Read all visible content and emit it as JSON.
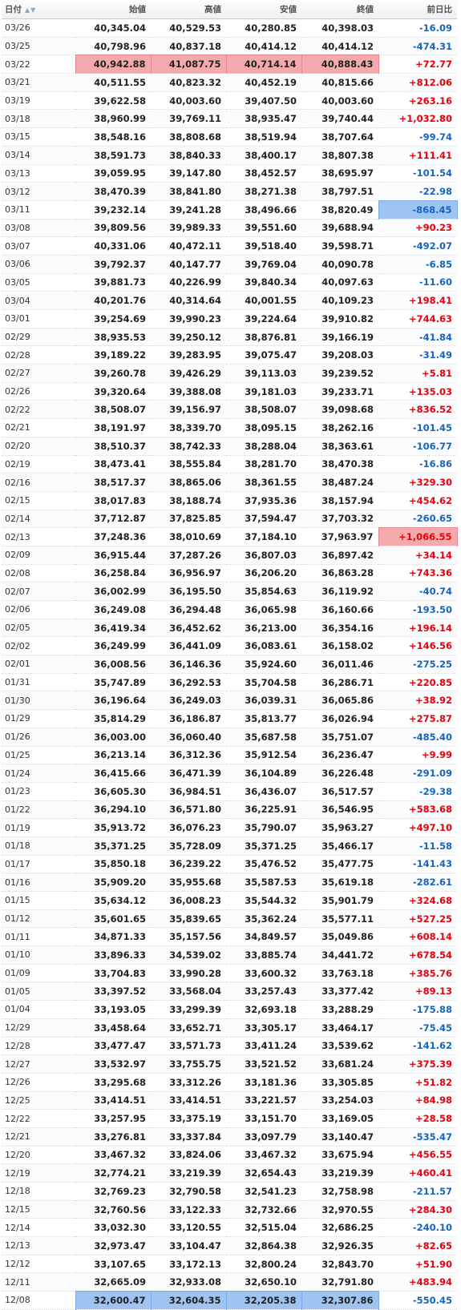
{
  "headers": {
    "date": "日付",
    "open": "始値",
    "high": "高値",
    "low": "安値",
    "close": "終値",
    "change": "前日比"
  },
  "colors": {
    "up": "#e8000d",
    "down": "#1565c0",
    "highlight_red": "#f4a9ad",
    "highlight_blue": "#9fc4f2"
  },
  "rows": [
    {
      "date": "03/26",
      "open": "40,345.04",
      "high": "40,529.53",
      "low": "40,280.85",
      "close": "40,398.03",
      "change": "-16.09"
    },
    {
      "date": "03/25",
      "open": "40,798.96",
      "high": "40,837.18",
      "low": "40,414.12",
      "close": "40,414.12",
      "change": "-474.31"
    },
    {
      "date": "03/22",
      "open": "40,942.88",
      "high": "41,087.75",
      "low": "40,714.14",
      "close": "40,888.43",
      "change": "+72.77",
      "hl": [
        "open",
        "high",
        "low",
        "close"
      ],
      "hlc": "red"
    },
    {
      "date": "03/21",
      "open": "40,511.55",
      "high": "40,823.32",
      "low": "40,452.19",
      "close": "40,815.66",
      "change": "+812.06"
    },
    {
      "date": "03/19",
      "open": "39,622.58",
      "high": "40,003.60",
      "low": "39,407.50",
      "close": "40,003.60",
      "change": "+263.16"
    },
    {
      "date": "03/18",
      "open": "38,960.99",
      "high": "39,769.11",
      "low": "38,935.47",
      "close": "39,740.44",
      "change": "+1,032.80"
    },
    {
      "date": "03/15",
      "open": "38,548.16",
      "high": "38,808.68",
      "low": "38,519.94",
      "close": "38,707.64",
      "change": "-99.74"
    },
    {
      "date": "03/14",
      "open": "38,591.73",
      "high": "38,840.33",
      "low": "38,400.17",
      "close": "38,807.38",
      "change": "+111.41"
    },
    {
      "date": "03/13",
      "open": "39,059.95",
      "high": "39,147.80",
      "low": "38,452.57",
      "close": "38,695.97",
      "change": "-101.54"
    },
    {
      "date": "03/12",
      "open": "38,470.39",
      "high": "38,841.80",
      "low": "38,271.38",
      "close": "38,797.51",
      "change": "-22.98"
    },
    {
      "date": "03/11",
      "open": "39,232.14",
      "high": "39,241.28",
      "low": "38,496.66",
      "close": "38,820.49",
      "change": "-868.45",
      "hl": [
        "change"
      ],
      "hlc": "blue"
    },
    {
      "date": "03/08",
      "open": "39,809.56",
      "high": "39,989.33",
      "low": "39,551.60",
      "close": "39,688.94",
      "change": "+90.23"
    },
    {
      "date": "03/07",
      "open": "40,331.06",
      "high": "40,472.11",
      "low": "39,518.40",
      "close": "39,598.71",
      "change": "-492.07"
    },
    {
      "date": "03/06",
      "open": "39,792.37",
      "high": "40,147.77",
      "low": "39,769.04",
      "close": "40,090.78",
      "change": "-6.85"
    },
    {
      "date": "03/05",
      "open": "39,881.73",
      "high": "40,226.99",
      "low": "39,840.34",
      "close": "40,097.63",
      "change": "-11.60"
    },
    {
      "date": "03/04",
      "open": "40,201.76",
      "high": "40,314.64",
      "low": "40,001.55",
      "close": "40,109.23",
      "change": "+198.41"
    },
    {
      "date": "03/01",
      "open": "39,254.69",
      "high": "39,990.23",
      "low": "39,224.64",
      "close": "39,910.82",
      "change": "+744.63"
    },
    {
      "date": "02/29",
      "open": "38,935.53",
      "high": "39,250.12",
      "low": "38,876.81",
      "close": "39,166.19",
      "change": "-41.84"
    },
    {
      "date": "02/28",
      "open": "39,189.22",
      "high": "39,283.95",
      "low": "39,075.47",
      "close": "39,208.03",
      "change": "-31.49"
    },
    {
      "date": "02/27",
      "open": "39,260.78",
      "high": "39,426.29",
      "low": "39,113.03",
      "close": "39,239.52",
      "change": "+5.81"
    },
    {
      "date": "02/26",
      "open": "39,320.64",
      "high": "39,388.08",
      "low": "39,181.03",
      "close": "39,233.71",
      "change": "+135.03"
    },
    {
      "date": "02/22",
      "open": "38,508.07",
      "high": "39,156.97",
      "low": "38,508.07",
      "close": "39,098.68",
      "change": "+836.52"
    },
    {
      "date": "02/21",
      "open": "38,191.97",
      "high": "38,339.70",
      "low": "38,095.15",
      "close": "38,262.16",
      "change": "-101.45"
    },
    {
      "date": "02/20",
      "open": "38,510.37",
      "high": "38,742.33",
      "low": "38,288.04",
      "close": "38,363.61",
      "change": "-106.77"
    },
    {
      "date": "02/19",
      "open": "38,473.41",
      "high": "38,555.84",
      "low": "38,281.70",
      "close": "38,470.38",
      "change": "-16.86"
    },
    {
      "date": "02/16",
      "open": "38,517.37",
      "high": "38,865.06",
      "low": "38,361.55",
      "close": "38,487.24",
      "change": "+329.30"
    },
    {
      "date": "02/15",
      "open": "38,017.83",
      "high": "38,188.74",
      "low": "37,935.36",
      "close": "38,157.94",
      "change": "+454.62"
    },
    {
      "date": "02/14",
      "open": "37,712.87",
      "high": "37,825.85",
      "low": "37,594.47",
      "close": "37,703.32",
      "change": "-260.65"
    },
    {
      "date": "02/13",
      "open": "37,248.36",
      "high": "38,010.69",
      "low": "37,184.10",
      "close": "37,963.97",
      "change": "+1,066.55",
      "hl": [
        "change"
      ],
      "hlc": "red"
    },
    {
      "date": "02/09",
      "open": "36,915.44",
      "high": "37,287.26",
      "low": "36,807.03",
      "close": "36,897.42",
      "change": "+34.14"
    },
    {
      "date": "02/08",
      "open": "36,258.84",
      "high": "36,956.97",
      "low": "36,206.20",
      "close": "36,863.28",
      "change": "+743.36"
    },
    {
      "date": "02/07",
      "open": "36,002.99",
      "high": "36,195.50",
      "low": "35,854.63",
      "close": "36,119.92",
      "change": "-40.74"
    },
    {
      "date": "02/06",
      "open": "36,249.08",
      "high": "36,294.48",
      "low": "36,065.98",
      "close": "36,160.66",
      "change": "-193.50"
    },
    {
      "date": "02/05",
      "open": "36,419.34",
      "high": "36,452.62",
      "low": "36,213.00",
      "close": "36,354.16",
      "change": "+196.14"
    },
    {
      "date": "02/02",
      "open": "36,249.99",
      "high": "36,441.09",
      "low": "36,083.61",
      "close": "36,158.02",
      "change": "+146.56"
    },
    {
      "date": "02/01",
      "open": "36,008.56",
      "high": "36,146.36",
      "low": "35,924.60",
      "close": "36,011.46",
      "change": "-275.25"
    },
    {
      "date": "01/31",
      "open": "35,747.89",
      "high": "36,292.53",
      "low": "35,704.58",
      "close": "36,286.71",
      "change": "+220.85"
    },
    {
      "date": "01/30",
      "open": "36,196.64",
      "high": "36,249.03",
      "low": "36,039.31",
      "close": "36,065.86",
      "change": "+38.92"
    },
    {
      "date": "01/29",
      "open": "35,814.29",
      "high": "36,186.87",
      "low": "35,813.77",
      "close": "36,026.94",
      "change": "+275.87"
    },
    {
      "date": "01/26",
      "open": "36,003.00",
      "high": "36,060.40",
      "low": "35,687.58",
      "close": "35,751.07",
      "change": "-485.40"
    },
    {
      "date": "01/25",
      "open": "36,213.14",
      "high": "36,312.36",
      "low": "35,912.54",
      "close": "36,236.47",
      "change": "+9.99"
    },
    {
      "date": "01/24",
      "open": "36,415.66",
      "high": "36,471.39",
      "low": "36,104.89",
      "close": "36,226.48",
      "change": "-291.09"
    },
    {
      "date": "01/23",
      "open": "36,605.30",
      "high": "36,984.51",
      "low": "36,436.07",
      "close": "36,517.57",
      "change": "-29.38"
    },
    {
      "date": "01/22",
      "open": "36,294.10",
      "high": "36,571.80",
      "low": "36,225.91",
      "close": "36,546.95",
      "change": "+583.68"
    },
    {
      "date": "01/19",
      "open": "35,913.72",
      "high": "36,076.23",
      "low": "35,790.07",
      "close": "35,963.27",
      "change": "+497.10"
    },
    {
      "date": "01/18",
      "open": "35,371.25",
      "high": "35,728.09",
      "low": "35,371.25",
      "close": "35,466.17",
      "change": "-11.58"
    },
    {
      "date": "01/17",
      "open": "35,850.18",
      "high": "36,239.22",
      "low": "35,476.52",
      "close": "35,477.75",
      "change": "-141.43"
    },
    {
      "date": "01/16",
      "open": "35,909.20",
      "high": "35,955.68",
      "low": "35,587.53",
      "close": "35,619.18",
      "change": "-282.61"
    },
    {
      "date": "01/15",
      "open": "35,634.12",
      "high": "36,008.23",
      "low": "35,544.32",
      "close": "35,901.79",
      "change": "+324.68"
    },
    {
      "date": "01/12",
      "open": "35,601.65",
      "high": "35,839.65",
      "low": "35,362.24",
      "close": "35,577.11",
      "change": "+527.25"
    },
    {
      "date": "01/11",
      "open": "34,871.33",
      "high": "35,157.56",
      "low": "34,849.57",
      "close": "35,049.86",
      "change": "+608.14"
    },
    {
      "date": "01/10",
      "open": "33,896.33",
      "high": "34,539.02",
      "low": "33,885.74",
      "close": "34,441.72",
      "change": "+678.54"
    },
    {
      "date": "01/09",
      "open": "33,704.83",
      "high": "33,990.28",
      "low": "33,600.32",
      "close": "33,763.18",
      "change": "+385.76"
    },
    {
      "date": "01/05",
      "open": "33,397.52",
      "high": "33,568.04",
      "low": "33,257.43",
      "close": "33,377.42",
      "change": "+89.13"
    },
    {
      "date": "01/04",
      "open": "33,193.05",
      "high": "33,299.39",
      "low": "32,693.18",
      "close": "33,288.29",
      "change": "-175.88"
    },
    {
      "date": "12/29",
      "open": "33,458.64",
      "high": "33,652.71",
      "low": "33,305.17",
      "close": "33,464.17",
      "change": "-75.45"
    },
    {
      "date": "12/28",
      "open": "33,477.47",
      "high": "33,571.73",
      "low": "33,411.24",
      "close": "33,539.62",
      "change": "-141.62"
    },
    {
      "date": "12/27",
      "open": "33,532.97",
      "high": "33,755.75",
      "low": "33,521.52",
      "close": "33,681.24",
      "change": "+375.39"
    },
    {
      "date": "12/26",
      "open": "33,295.68",
      "high": "33,312.26",
      "low": "33,181.36",
      "close": "33,305.85",
      "change": "+51.82"
    },
    {
      "date": "12/25",
      "open": "33,414.51",
      "high": "33,414.51",
      "low": "33,221.57",
      "close": "33,254.03",
      "change": "+84.98"
    },
    {
      "date": "12/22",
      "open": "33,257.95",
      "high": "33,375.19",
      "low": "33,151.70",
      "close": "33,169.05",
      "change": "+28.58"
    },
    {
      "date": "12/21",
      "open": "33,276.81",
      "high": "33,337.84",
      "low": "33,097.79",
      "close": "33,140.47",
      "change": "-535.47"
    },
    {
      "date": "12/20",
      "open": "33,467.32",
      "high": "33,824.06",
      "low": "33,467.32",
      "close": "33,675.94",
      "change": "+456.55"
    },
    {
      "date": "12/19",
      "open": "32,774.21",
      "high": "33,219.39",
      "low": "32,654.43",
      "close": "33,219.39",
      "change": "+460.41"
    },
    {
      "date": "12/18",
      "open": "32,769.23",
      "high": "32,790.58",
      "low": "32,541.23",
      "close": "32,758.98",
      "change": "-211.57"
    },
    {
      "date": "12/15",
      "open": "32,760.56",
      "high": "33,122.33",
      "low": "32,732.66",
      "close": "32,970.55",
      "change": "+284.30"
    },
    {
      "date": "12/14",
      "open": "33,032.30",
      "high": "33,120.55",
      "low": "32,515.04",
      "close": "32,686.25",
      "change": "-240.10"
    },
    {
      "date": "12/13",
      "open": "32,973.47",
      "high": "33,104.47",
      "low": "32,864.38",
      "close": "32,926.35",
      "change": "+82.65"
    },
    {
      "date": "12/12",
      "open": "33,107.65",
      "high": "33,172.13",
      "low": "32,800.24",
      "close": "32,843.70",
      "change": "+51.90"
    },
    {
      "date": "12/11",
      "open": "32,665.09",
      "high": "32,933.08",
      "low": "32,650.10",
      "close": "32,791.80",
      "change": "+483.94"
    },
    {
      "date": "12/08",
      "open": "32,600.47",
      "high": "32,604.35",
      "low": "32,205.38",
      "close": "32,307.86",
      "change": "-550.45",
      "hl": [
        "open",
        "high",
        "low",
        "close"
      ],
      "hlc": "blue"
    }
  ]
}
